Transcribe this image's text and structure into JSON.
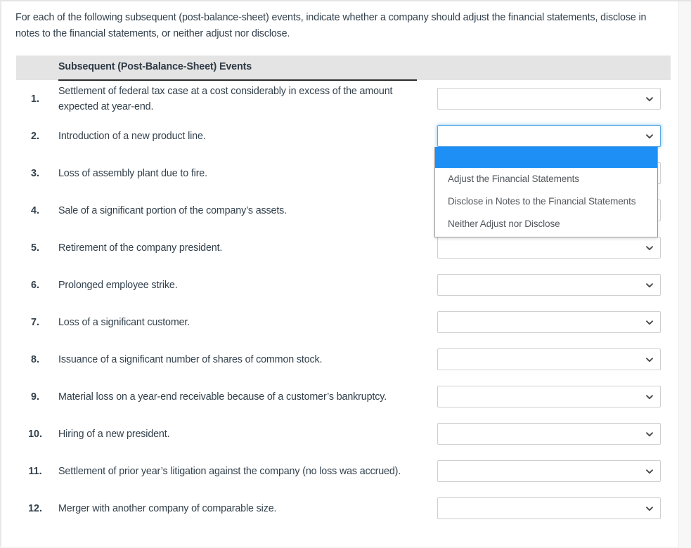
{
  "instructions": "For each of the following subsequent (post-balance-sheet) events, indicate whether a company should adjust the financial statements, disclose in notes to the financial statements, or neither adjust nor disclose.",
  "table": {
    "header": "Subsequent (Post-Balance-Sheet) Events",
    "rows": [
      {
        "number": "1.",
        "description": "Settlement of federal tax case at a cost considerably in excess of the amount expected at year-end.",
        "value": ""
      },
      {
        "number": "2.",
        "description": "Introduction of a new product line.",
        "value": ""
      },
      {
        "number": "3.",
        "description": "Loss of assembly plant due to fire.",
        "value": ""
      },
      {
        "number": "4.",
        "description": "Sale of a significant portion of the company’s assets.",
        "value": ""
      },
      {
        "number": "5.",
        "description": "Retirement of the company president.",
        "value": ""
      },
      {
        "number": "6.",
        "description": "Prolonged employee strike.",
        "value": ""
      },
      {
        "number": "7.",
        "description": "Loss of a significant customer.",
        "value": ""
      },
      {
        "number": "8.",
        "description": "Issuance of a significant number of shares of common stock.",
        "value": ""
      },
      {
        "number": "9.",
        "description": "Material loss on a year-end receivable because of a customer’s bankruptcy.",
        "value": ""
      },
      {
        "number": "10.",
        "description": "Hiring of a new president.",
        "value": ""
      },
      {
        "number": "11.",
        "description": "Settlement of prior year’s litigation against the company (no loss was accrued).",
        "value": ""
      },
      {
        "number": "12.",
        "description": "Merger with another company of comparable size.",
        "value": ""
      }
    ]
  },
  "dropdown": {
    "open_row_index": 1,
    "selected_option": "",
    "options": [
      "",
      "Adjust the Financial Statements",
      "Disclose in Notes to the Financial Statements",
      "Neither Adjust nor Disclose"
    ]
  },
  "colors": {
    "header_band": "#e4e4e4",
    "highlight_blue": "#1e90f5",
    "focus_border": "#5aa9e6",
    "text": "#32404b"
  },
  "icons": {
    "chevron": "chevron-down-icon"
  }
}
